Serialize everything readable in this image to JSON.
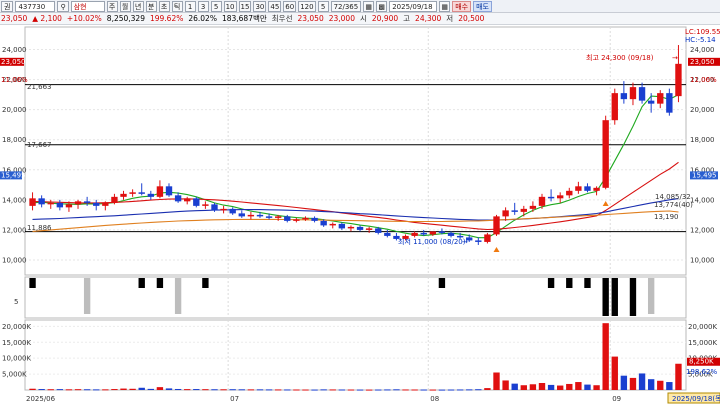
{
  "toolbar": {
    "menu_label": "권",
    "code": "437730",
    "stock_name": "삼현",
    "period_buttons": [
      "주",
      "월",
      "년",
      "분",
      "초",
      "틱"
    ],
    "interval_buttons": [
      "1",
      "3",
      "5",
      "10",
      "15",
      "30",
      "45",
      "60",
      "120"
    ],
    "extra_button": "5",
    "count_display": "72/365",
    "date": "2025/09/18",
    "buy_label": "매수",
    "sell_label": "매도"
  },
  "quote": {
    "price": "23,050",
    "change": "2,100",
    "change_rate": "+10.02%",
    "volume": "8,250,329",
    "volume_ratio": "199.62%",
    "turnover_rate": "26.02%",
    "trade_value": "183,687백만",
    "prefix_label": "최우선",
    "best_price": "23,050",
    "best_price2": "23,000",
    "open_label": "시",
    "open": "20,900",
    "high_label": "고",
    "high": "24,300",
    "low_label": "저",
    "low": "20,500"
  },
  "price_axis": {
    "ticks": [
      {
        "value": 24000,
        "label": "24,000"
      },
      {
        "value": 22000,
        "label": "22,000"
      },
      {
        "value": 20000,
        "label": "20,000"
      },
      {
        "value": 18000,
        "label": "18,000"
      },
      {
        "value": 16000,
        "label": "16,000"
      },
      {
        "value": 14000,
        "label": "14,000"
      },
      {
        "value": 12000,
        "label": "12,000"
      },
      {
        "value": 10000,
        "label": "10,000"
      }
    ],
    "current_label": "23,050",
    "current_pct": "11.06%",
    "right_current_label": "23,050",
    "right_current_pct": "11.06%",
    "right_low_label": "15,495",
    "left_low_label": "15,495",
    "lc_label": "LC:109.55",
    "hc_label": "HC:-5.14",
    "levels": [
      {
        "value": 21663,
        "label": "21,663"
      },
      {
        "value": 17667,
        "label": "17,667"
      },
      {
        "value": 11886,
        "label": "11,886"
      }
    ]
  },
  "annotations": {
    "high_text": "최고 24,300 (09/18)",
    "low_text": "최저 11,000 (08/20)",
    "ma_labels": [
      "14,085/32",
      "13,774(40)",
      "13,190"
    ]
  },
  "volume_axis": {
    "ticks": [
      {
        "value": 20000000,
        "label": "20,000K"
      },
      {
        "value": 15000000,
        "label": "15,000K"
      },
      {
        "value": 10000000,
        "label": "10,000K"
      },
      {
        "value": 5000000,
        "label": "5,000K"
      }
    ],
    "current_label": "8,250K",
    "sub_label": "198,62%"
  },
  "indicator_axis": {
    "label": "5"
  },
  "time_axis": {
    "labels": [
      "2025/06",
      "07",
      "08",
      "09"
    ],
    "current_date": "2025/09/18(목)"
  },
  "colors": {
    "up": "#e01010",
    "down": "#1a3fd0",
    "ma5": "#1fa91f",
    "ma20": "#d81010",
    "ma60": "#1a2fb0",
    "ma120": "#e08020",
    "gray_ma": "#888888",
    "level_line": "#000000"
  },
  "chart_data": {
    "type": "candlestick",
    "x_categories": [
      "2025/06",
      "07",
      "08",
      "09"
    ],
    "ylim": [
      9000,
      25500
    ],
    "volume_ylim": [
      0,
      22000000
    ],
    "candles": [
      [
        13600,
        14500,
        13300,
        14100
      ],
      [
        14100,
        14300,
        13500,
        13700
      ],
      [
        13700,
        14000,
        13400,
        13800
      ],
      [
        13800,
        14000,
        13300,
        13500
      ],
      [
        13500,
        13900,
        13200,
        13700
      ],
      [
        13700,
        14000,
        13400,
        13900
      ],
      [
        13900,
        14200,
        13600,
        13800
      ],
      [
        13800,
        14000,
        13300,
        13600
      ],
      [
        13600,
        13900,
        13300,
        13800
      ],
      [
        13800,
        14400,
        13700,
        14200
      ],
      [
        14200,
        14600,
        14000,
        14400
      ],
      [
        14400,
        14700,
        14200,
        14500
      ],
      [
        14500,
        15100,
        14300,
        14400
      ],
      [
        14400,
        14600,
        14000,
        14200
      ],
      [
        14200,
        15300,
        14100,
        14900
      ],
      [
        14900,
        15100,
        14200,
        14300
      ],
      [
        14300,
        14500,
        13800,
        13900
      ],
      [
        13900,
        14200,
        13700,
        14100
      ],
      [
        14100,
        14200,
        13500,
        13600
      ],
      [
        13600,
        13900,
        13400,
        13700
      ],
      [
        13700,
        13800,
        13200,
        13300
      ],
      [
        13300,
        13600,
        13100,
        13400
      ],
      [
        13400,
        13500,
        13000,
        13100
      ],
      [
        13100,
        13300,
        12800,
        12900
      ],
      [
        12900,
        13200,
        12700,
        13000
      ],
      [
        13000,
        13200,
        12800,
        12900
      ],
      [
        12900,
        13100,
        12700,
        12800
      ],
      [
        12800,
        13000,
        12600,
        12900
      ],
      [
        12900,
        13000,
        12500,
        12600
      ],
      [
        12600,
        12800,
        12500,
        12700
      ],
      [
        12700,
        12900,
        12600,
        12800
      ],
      [
        12800,
        12900,
        12500,
        12600
      ],
      [
        12600,
        12700,
        12200,
        12300
      ],
      [
        12300,
        12500,
        12100,
        12400
      ],
      [
        12400,
        12500,
        12000,
        12100
      ],
      [
        12100,
        12300,
        11900,
        12200
      ],
      [
        12200,
        12300,
        11900,
        12000
      ],
      [
        12000,
        12200,
        11800,
        12100
      ],
      [
        12100,
        12200,
        11700,
        11800
      ],
      [
        11800,
        12000,
        11500,
        11600
      ],
      [
        11600,
        11800,
        11300,
        11400
      ],
      [
        11400,
        11700,
        11300,
        11600
      ],
      [
        11600,
        11900,
        11500,
        11800
      ],
      [
        11800,
        12000,
        11600,
        11700
      ],
      [
        11700,
        11900,
        11600,
        11900
      ],
      [
        11900,
        12100,
        11700,
        11800
      ],
      [
        11800,
        11900,
        11500,
        11600
      ],
      [
        11600,
        11800,
        11400,
        11500
      ],
      [
        11500,
        11700,
        11200,
        11300
      ],
      [
        11300,
        11500,
        11000,
        11200
      ],
      [
        11200,
        11800,
        11100,
        11700
      ],
      [
        11700,
        13000,
        11600,
        12900
      ],
      [
        12900,
        13500,
        12600,
        13300
      ],
      [
        13300,
        13800,
        13000,
        13200
      ],
      [
        13200,
        13600,
        12900,
        13400
      ],
      [
        13400,
        13900,
        13200,
        13600
      ],
      [
        13600,
        14400,
        13400,
        14200
      ],
      [
        14200,
        14700,
        13900,
        14100
      ],
      [
        14100,
        14500,
        13800,
        14300
      ],
      [
        14300,
        14800,
        14100,
        14600
      ],
      [
        14600,
        15200,
        14400,
        14900
      ],
      [
        14900,
        15100,
        14500,
        14600
      ],
      [
        14600,
        14900,
        14300,
        14800
      ],
      [
        14800,
        19600,
        14700,
        19300
      ],
      [
        19300,
        21400,
        19000,
        21100
      ],
      [
        21100,
        21900,
        20400,
        20700
      ],
      [
        20700,
        21800,
        20300,
        21500
      ],
      [
        21500,
        21800,
        20400,
        20600
      ],
      [
        20600,
        21100,
        19800,
        20400
      ],
      [
        20400,
        21300,
        20100,
        21100
      ],
      [
        21100,
        21400,
        19600,
        19800
      ],
      [
        20900,
        24300,
        20500,
        23050
      ]
    ],
    "volumes": [
      400000,
      300000,
      250000,
      280000,
      220000,
      260000,
      240000,
      200000,
      210000,
      300000,
      450000,
      380000,
      700000,
      350000,
      900000,
      500000,
      320000,
      280000,
      300000,
      260000,
      240000,
      230000,
      250000,
      220000,
      200000,
      210000,
      190000,
      180000,
      170000,
      160000,
      150000,
      140000,
      200000,
      180000,
      160000,
      150000,
      140000,
      130000,
      150000,
      180000,
      220000,
      170000,
      160000,
      150000,
      140000,
      130000,
      150000,
      170000,
      200000,
      250000,
      600000,
      5500000,
      3000000,
      2000000,
      1500000,
      1800000,
      2200000,
      1600000,
      1400000,
      1900000,
      2500000,
      1700000,
      1500000,
      21000000,
      10500000,
      4500000,
      3800000,
      5200000,
      3400000,
      2900000,
      2500000,
      8250329
    ],
    "moving_averages": [
      {
        "name": "ma5",
        "values": [
          13800,
          13850,
          13780,
          13740,
          13720,
          13700,
          13740,
          13720,
          13760,
          13820,
          13950,
          14100,
          14200,
          14250,
          14450,
          14500,
          14450,
          14350,
          14200,
          14000,
          13800,
          13650,
          13550,
          13400,
          13250,
          13150,
          13050,
          12950,
          12880,
          12820,
          12780,
          12760,
          12680,
          12600,
          12500,
          12420,
          12320,
          12250,
          12150,
          12050,
          11900,
          11780,
          11680,
          11620,
          11680,
          11750,
          11780,
          11720,
          11620,
          11480,
          11480,
          11820,
          12250,
          12650,
          13000,
          13300,
          13540,
          13680,
          13780,
          13980,
          14220,
          14420,
          14560,
          15500,
          16600,
          17700,
          18900,
          20200,
          20900,
          20860,
          20680,
          21000
        ]
      },
      {
        "name": "ma20",
        "values": [
          13900,
          13880,
          13860,
          13840,
          13820,
          13800,
          13800,
          13800,
          13810,
          13830,
          13860,
          13900,
          13940,
          13980,
          14020,
          14050,
          14060,
          14060,
          14050,
          14030,
          14000,
          13960,
          13910,
          13860,
          13800,
          13740,
          13680,
          13620,
          13560,
          13490,
          13420,
          13350,
          13280,
          13210,
          13130,
          13050,
          12980,
          12900,
          12830,
          12750,
          12660,
          12580,
          12500,
          12430,
          12370,
          12310,
          12250,
          12190,
          12130,
          12070,
          12030,
          12050,
          12100,
          12160,
          12230,
          12300,
          12380,
          12460,
          12540,
          12630,
          12730,
          12830,
          12940,
          13300,
          13700,
          14100,
          14500,
          14900,
          15300,
          15700,
          16050,
          16500
        ]
      },
      {
        "name": "ma60",
        "values": [
          12700,
          12720,
          12740,
          12760,
          12790,
          12820,
          12850,
          12880,
          12910,
          12940,
          12980,
          13020,
          13060,
          13100,
          13140,
          13180,
          13220,
          13250,
          13280,
          13300,
          13320,
          13330,
          13340,
          13350,
          13350,
          13350,
          13340,
          13330,
          13310,
          13290,
          13270,
          13250,
          13220,
          13190,
          13160,
          13120,
          13080,
          13050,
          13010,
          12970,
          12930,
          12890,
          12850,
          12820,
          12790,
          12760,
          12730,
          12700,
          12680,
          12660,
          12650,
          12660,
          12680,
          12700,
          12730,
          12760,
          12800,
          12840,
          12880,
          12930,
          12980,
          13030,
          13090,
          13200,
          13320,
          13440,
          13560,
          13680,
          13800,
          13900,
          14000,
          14085
        ]
      },
      {
        "name": "ma120",
        "values": [
          11900,
          11950,
          12000,
          12050,
          12100,
          12150,
          12200,
          12250,
          12300,
          12340,
          12380,
          12420,
          12460,
          12500,
          12530,
          12560,
          12590,
          12610,
          12630,
          12650,
          12670,
          12680,
          12690,
          12700,
          12700,
          12700,
          12700,
          12700,
          12690,
          12680,
          12670,
          12660,
          12650,
          12640,
          12630,
          12620,
          12610,
          12600,
          12590,
          12580,
          12570,
          12560,
          12560,
          12560,
          12560,
          12560,
          12570,
          12580,
          12590,
          12600,
          12620,
          12650,
          12680,
          12710,
          12740,
          12770,
          12800,
          12830,
          12860,
          12890,
          12920,
          12950,
          12980,
          13020,
          13060,
          13100,
          13140,
          13180,
          13210,
          13240,
          13260,
          13190
        ]
      }
    ],
    "indicator_marks": [
      {
        "i": 0,
        "kind": "black"
      },
      {
        "i": 6,
        "kind": "gray"
      },
      {
        "i": 12,
        "kind": "black"
      },
      {
        "i": 14,
        "kind": "black"
      },
      {
        "i": 16,
        "kind": "gray"
      },
      {
        "i": 19,
        "kind": "black"
      },
      {
        "i": 45,
        "kind": "black"
      },
      {
        "i": 57,
        "kind": "black"
      },
      {
        "i": 59,
        "kind": "black"
      },
      {
        "i": 61,
        "kind": "black"
      },
      {
        "i": 63,
        "kind": "black"
      },
      {
        "i": 64,
        "kind": "black"
      },
      {
        "i": 66,
        "kind": "black"
      },
      {
        "i": 68,
        "kind": "gray"
      }
    ]
  }
}
